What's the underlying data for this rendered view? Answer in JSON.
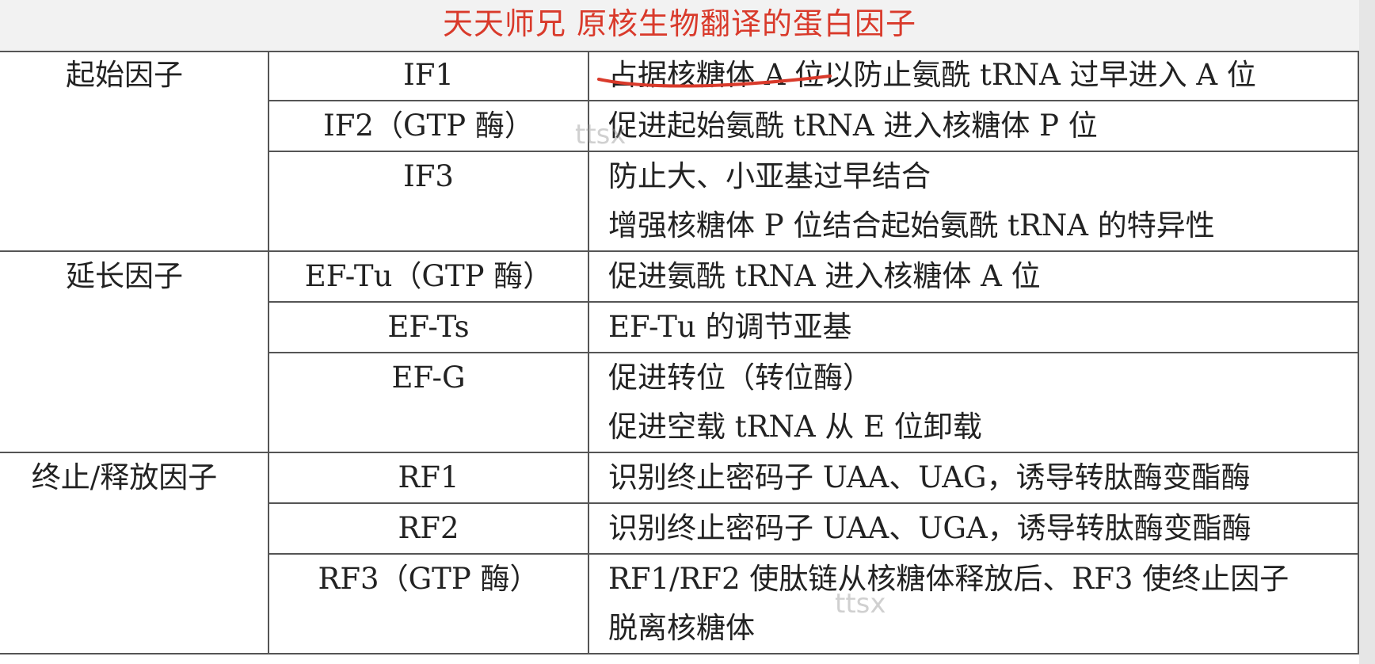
{
  "title": "天天师兄  原核生物翻译的蛋白因子",
  "colors": {
    "title_text": "#d93a2b",
    "title_bg": "#f2f2f2",
    "grid_line": "#555555",
    "annotation_stroke": "#d93a2b"
  },
  "watermark": "ttsx",
  "groups": [
    {
      "category": "起始因子",
      "rows": [
        {
          "name": "IF1",
          "functions": [
            "占据核糖体 A 位以防止氨酰 tRNA 过早进入 A 位"
          ]
        },
        {
          "name": "IF2（GTP 酶）",
          "functions": [
            "促进起始氨酰 tRNA 进入核糖体 P 位"
          ]
        },
        {
          "name": "IF3",
          "functions": [
            "防止大、小亚基过早结合",
            "增强核糖体 P 位结合起始氨酰 tRNA 的特异性"
          ]
        }
      ]
    },
    {
      "category": "延长因子",
      "rows": [
        {
          "name": "EF-Tu（GTP 酶）",
          "functions": [
            "促进氨酰 tRNA 进入核糖体 A 位"
          ]
        },
        {
          "name": "EF-Ts",
          "functions": [
            "EF-Tu 的调节亚基"
          ]
        },
        {
          "name": "EF-G",
          "functions": [
            "促进转位（转位酶）",
            "促进空载 tRNA 从 E 位卸载"
          ]
        }
      ]
    },
    {
      "category": "终止/释放因子",
      "rows": [
        {
          "name": "RF1",
          "functions": [
            "识别终止密码子 UAA、UAG，诱导转肽酶变酯酶"
          ]
        },
        {
          "name": "RF2",
          "functions": [
            "识别终止密码子 UAA、UGA，诱导转肽酶变酯酶"
          ]
        },
        {
          "name": "RF3（GTP 酶）",
          "functions": [
            "RF1/RF2 使肽链从核糖体释放后、RF3 使终止因子",
            "脱离核糖体"
          ]
        }
      ]
    }
  ]
}
